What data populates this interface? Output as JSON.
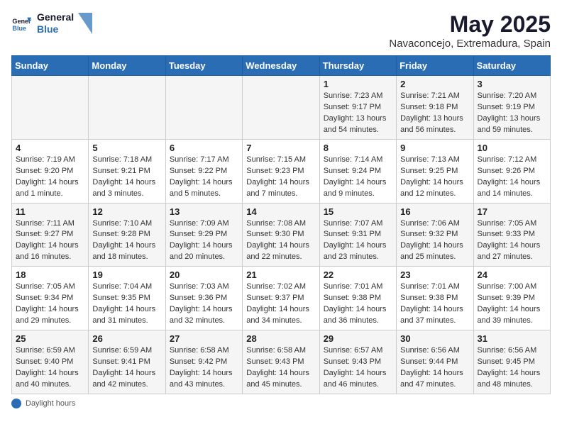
{
  "header": {
    "logo_line1": "General",
    "logo_line2": "Blue",
    "month": "May 2025",
    "location": "Navaconcejo, Extremadura, Spain"
  },
  "weekdays": [
    "Sunday",
    "Monday",
    "Tuesday",
    "Wednesday",
    "Thursday",
    "Friday",
    "Saturday"
  ],
  "weeks": [
    [
      {
        "day": "",
        "info": ""
      },
      {
        "day": "",
        "info": ""
      },
      {
        "day": "",
        "info": ""
      },
      {
        "day": "",
        "info": ""
      },
      {
        "day": "1",
        "info": "Sunrise: 7:23 AM\nSunset: 9:17 PM\nDaylight: 13 hours\nand 54 minutes."
      },
      {
        "day": "2",
        "info": "Sunrise: 7:21 AM\nSunset: 9:18 PM\nDaylight: 13 hours\nand 56 minutes."
      },
      {
        "day": "3",
        "info": "Sunrise: 7:20 AM\nSunset: 9:19 PM\nDaylight: 13 hours\nand 59 minutes."
      }
    ],
    [
      {
        "day": "4",
        "info": "Sunrise: 7:19 AM\nSunset: 9:20 PM\nDaylight: 14 hours\nand 1 minute."
      },
      {
        "day": "5",
        "info": "Sunrise: 7:18 AM\nSunset: 9:21 PM\nDaylight: 14 hours\nand 3 minutes."
      },
      {
        "day": "6",
        "info": "Sunrise: 7:17 AM\nSunset: 9:22 PM\nDaylight: 14 hours\nand 5 minutes."
      },
      {
        "day": "7",
        "info": "Sunrise: 7:15 AM\nSunset: 9:23 PM\nDaylight: 14 hours\nand 7 minutes."
      },
      {
        "day": "8",
        "info": "Sunrise: 7:14 AM\nSunset: 9:24 PM\nDaylight: 14 hours\nand 9 minutes."
      },
      {
        "day": "9",
        "info": "Sunrise: 7:13 AM\nSunset: 9:25 PM\nDaylight: 14 hours\nand 12 minutes."
      },
      {
        "day": "10",
        "info": "Sunrise: 7:12 AM\nSunset: 9:26 PM\nDaylight: 14 hours\nand 14 minutes."
      }
    ],
    [
      {
        "day": "11",
        "info": "Sunrise: 7:11 AM\nSunset: 9:27 PM\nDaylight: 14 hours\nand 16 minutes."
      },
      {
        "day": "12",
        "info": "Sunrise: 7:10 AM\nSunset: 9:28 PM\nDaylight: 14 hours\nand 18 minutes."
      },
      {
        "day": "13",
        "info": "Sunrise: 7:09 AM\nSunset: 9:29 PM\nDaylight: 14 hours\nand 20 minutes."
      },
      {
        "day": "14",
        "info": "Sunrise: 7:08 AM\nSunset: 9:30 PM\nDaylight: 14 hours\nand 22 minutes."
      },
      {
        "day": "15",
        "info": "Sunrise: 7:07 AM\nSunset: 9:31 PM\nDaylight: 14 hours\nand 23 minutes."
      },
      {
        "day": "16",
        "info": "Sunrise: 7:06 AM\nSunset: 9:32 PM\nDaylight: 14 hours\nand 25 minutes."
      },
      {
        "day": "17",
        "info": "Sunrise: 7:05 AM\nSunset: 9:33 PM\nDaylight: 14 hours\nand 27 minutes."
      }
    ],
    [
      {
        "day": "18",
        "info": "Sunrise: 7:05 AM\nSunset: 9:34 PM\nDaylight: 14 hours\nand 29 minutes."
      },
      {
        "day": "19",
        "info": "Sunrise: 7:04 AM\nSunset: 9:35 PM\nDaylight: 14 hours\nand 31 minutes."
      },
      {
        "day": "20",
        "info": "Sunrise: 7:03 AM\nSunset: 9:36 PM\nDaylight: 14 hours\nand 32 minutes."
      },
      {
        "day": "21",
        "info": "Sunrise: 7:02 AM\nSunset: 9:37 PM\nDaylight: 14 hours\nand 34 minutes."
      },
      {
        "day": "22",
        "info": "Sunrise: 7:01 AM\nSunset: 9:38 PM\nDaylight: 14 hours\nand 36 minutes."
      },
      {
        "day": "23",
        "info": "Sunrise: 7:01 AM\nSunset: 9:38 PM\nDaylight: 14 hours\nand 37 minutes."
      },
      {
        "day": "24",
        "info": "Sunrise: 7:00 AM\nSunset: 9:39 PM\nDaylight: 14 hours\nand 39 minutes."
      }
    ],
    [
      {
        "day": "25",
        "info": "Sunrise: 6:59 AM\nSunset: 9:40 PM\nDaylight: 14 hours\nand 40 minutes."
      },
      {
        "day": "26",
        "info": "Sunrise: 6:59 AM\nSunset: 9:41 PM\nDaylight: 14 hours\nand 42 minutes."
      },
      {
        "day": "27",
        "info": "Sunrise: 6:58 AM\nSunset: 9:42 PM\nDaylight: 14 hours\nand 43 minutes."
      },
      {
        "day": "28",
        "info": "Sunrise: 6:58 AM\nSunset: 9:43 PM\nDaylight: 14 hours\nand 45 minutes."
      },
      {
        "day": "29",
        "info": "Sunrise: 6:57 AM\nSunset: 9:43 PM\nDaylight: 14 hours\nand 46 minutes."
      },
      {
        "day": "30",
        "info": "Sunrise: 6:56 AM\nSunset: 9:44 PM\nDaylight: 14 hours\nand 47 minutes."
      },
      {
        "day": "31",
        "info": "Sunrise: 6:56 AM\nSunset: 9:45 PM\nDaylight: 14 hours\nand 48 minutes."
      }
    ]
  ],
  "footer": {
    "label": "Daylight hours"
  }
}
